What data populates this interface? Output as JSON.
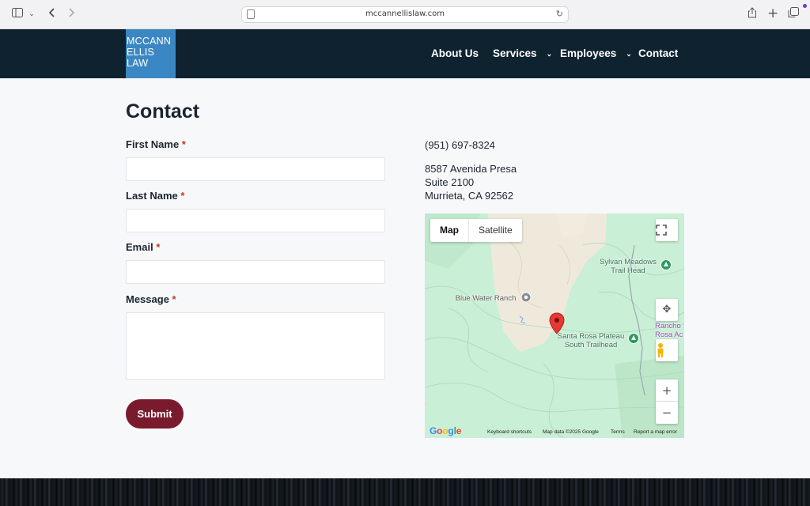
{
  "browser": {
    "url": "mccannellislaw.com",
    "icons": [
      "sidebar-icon",
      "chevron-down-icon",
      "back-icon",
      "forward-icon",
      "page-icon",
      "reload-icon",
      "share-icon",
      "new-tab-icon",
      "tabs-icon"
    ]
  },
  "header": {
    "logo_lines": [
      "MCCANN",
      "ELLIS",
      "LAW"
    ],
    "nav": [
      {
        "label": "About Us",
        "has_dropdown": false
      },
      {
        "label": "Services",
        "has_dropdown": true
      },
      {
        "label": "Employees",
        "has_dropdown": true
      },
      {
        "label": "Contact",
        "has_dropdown": false
      }
    ],
    "chevron": "⌄"
  },
  "main": {
    "title": "Contact",
    "form": {
      "required_mark": "*",
      "first_name_label": "First Name",
      "last_name_label": "Last Name",
      "email_label": "Email",
      "message_label": "Message",
      "first_name_value": "",
      "last_name_value": "",
      "email_value": "",
      "message_value": "",
      "submit_label": "Submit"
    },
    "contact": {
      "phone": "(951) 697-8324",
      "address_line1": "8587 Avenida Presa",
      "address_line2": "Suite 2100",
      "address_line3": "Murrieta, CA 92562"
    },
    "map": {
      "type_map": "Map",
      "type_satellite": "Satellite",
      "place_sylvan_1": "Sylvan Meadows",
      "place_sylvan_2": "Trail Head",
      "place_bluewater": "Blue Water Ranch",
      "place_santa_1": "Santa Rosa Plateau",
      "place_santa_2": "South Trailhead",
      "place_rancho_1": "Rancho",
      "place_rancho_2": "Rosa Ac",
      "zoom_in": "+",
      "zoom_out": "−",
      "google": "Google",
      "keyboard": "Keyboard shortcuts",
      "map_data": "Map data ©2025 Google",
      "terms": "Terms",
      "report": "Report a map error"
    }
  },
  "colors": {
    "header_bg": "#0f2230",
    "logo_bg": "#3b87c3",
    "submit_bg": "#7a1a2d",
    "required": "#c0392b"
  }
}
